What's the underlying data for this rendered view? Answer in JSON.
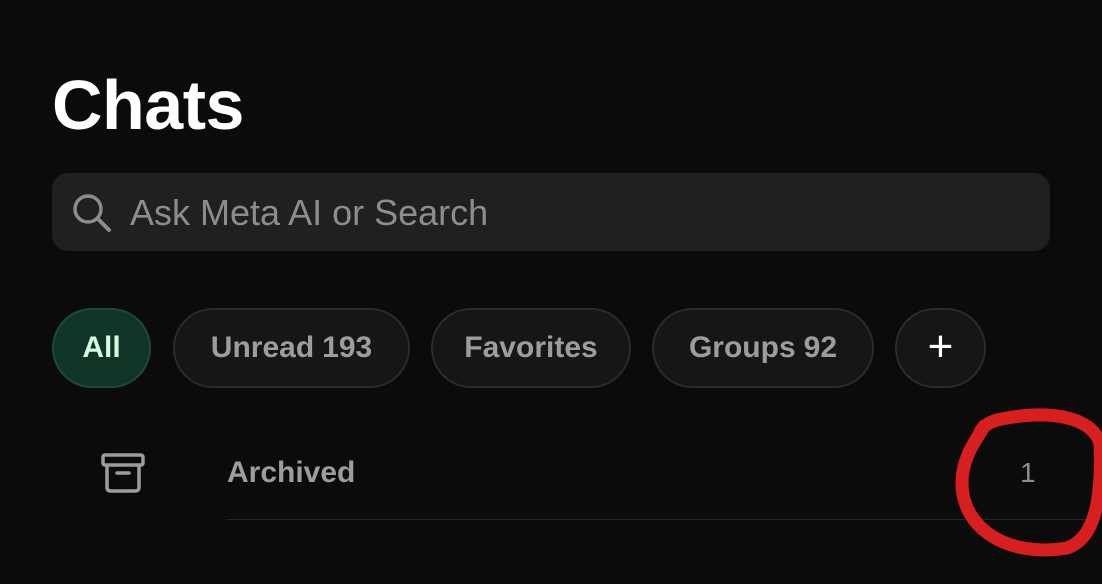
{
  "header": {
    "title": "Chats"
  },
  "search": {
    "placeholder": "Ask Meta AI or Search",
    "icon": "search-icon"
  },
  "filters": {
    "all": {
      "label": "All",
      "active": true
    },
    "unread": {
      "label": "Unread",
      "count": "193"
    },
    "favorites": {
      "label": "Favorites"
    },
    "groups": {
      "label": "Groups",
      "count": "92"
    },
    "add": {
      "label": "+",
      "icon": "plus-icon"
    }
  },
  "archived": {
    "label": "Archived",
    "count": "1",
    "icon": "archive-icon"
  },
  "annotation": {
    "color": "#d81f1f",
    "shape": "hand-drawn-circle"
  },
  "colors": {
    "background": "#0b0b0b",
    "search_background": "#202020",
    "active_chip_background": "#103527",
    "active_chip_text": "#d7f7df",
    "muted_text": "#9d9d9d"
  }
}
